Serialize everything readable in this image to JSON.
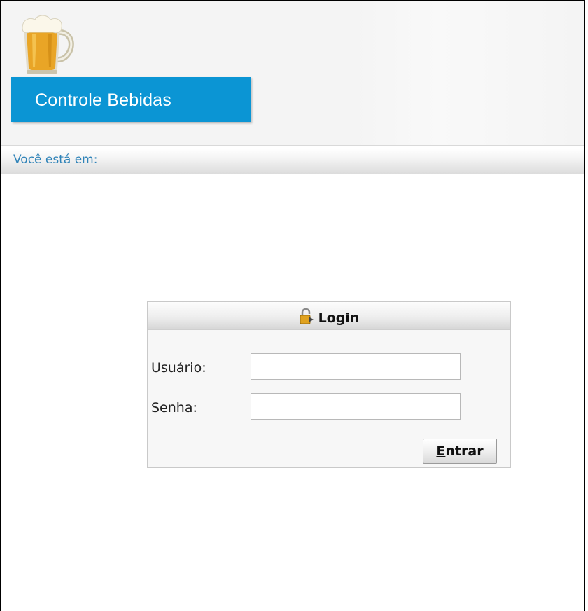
{
  "header": {
    "logo_icon": "beer-mug-icon",
    "brand_title": "Controle Bebidas",
    "brand_color": "#0b95d4"
  },
  "breadcrumb": {
    "label": "Você está em:"
  },
  "login": {
    "title": "Login",
    "title_icon": "lock-icon",
    "username_label": "Usuário:",
    "username_value": "",
    "password_label": "Senha:",
    "password_value": "",
    "submit_accesskey": "E",
    "submit_rest": "ntrar"
  }
}
